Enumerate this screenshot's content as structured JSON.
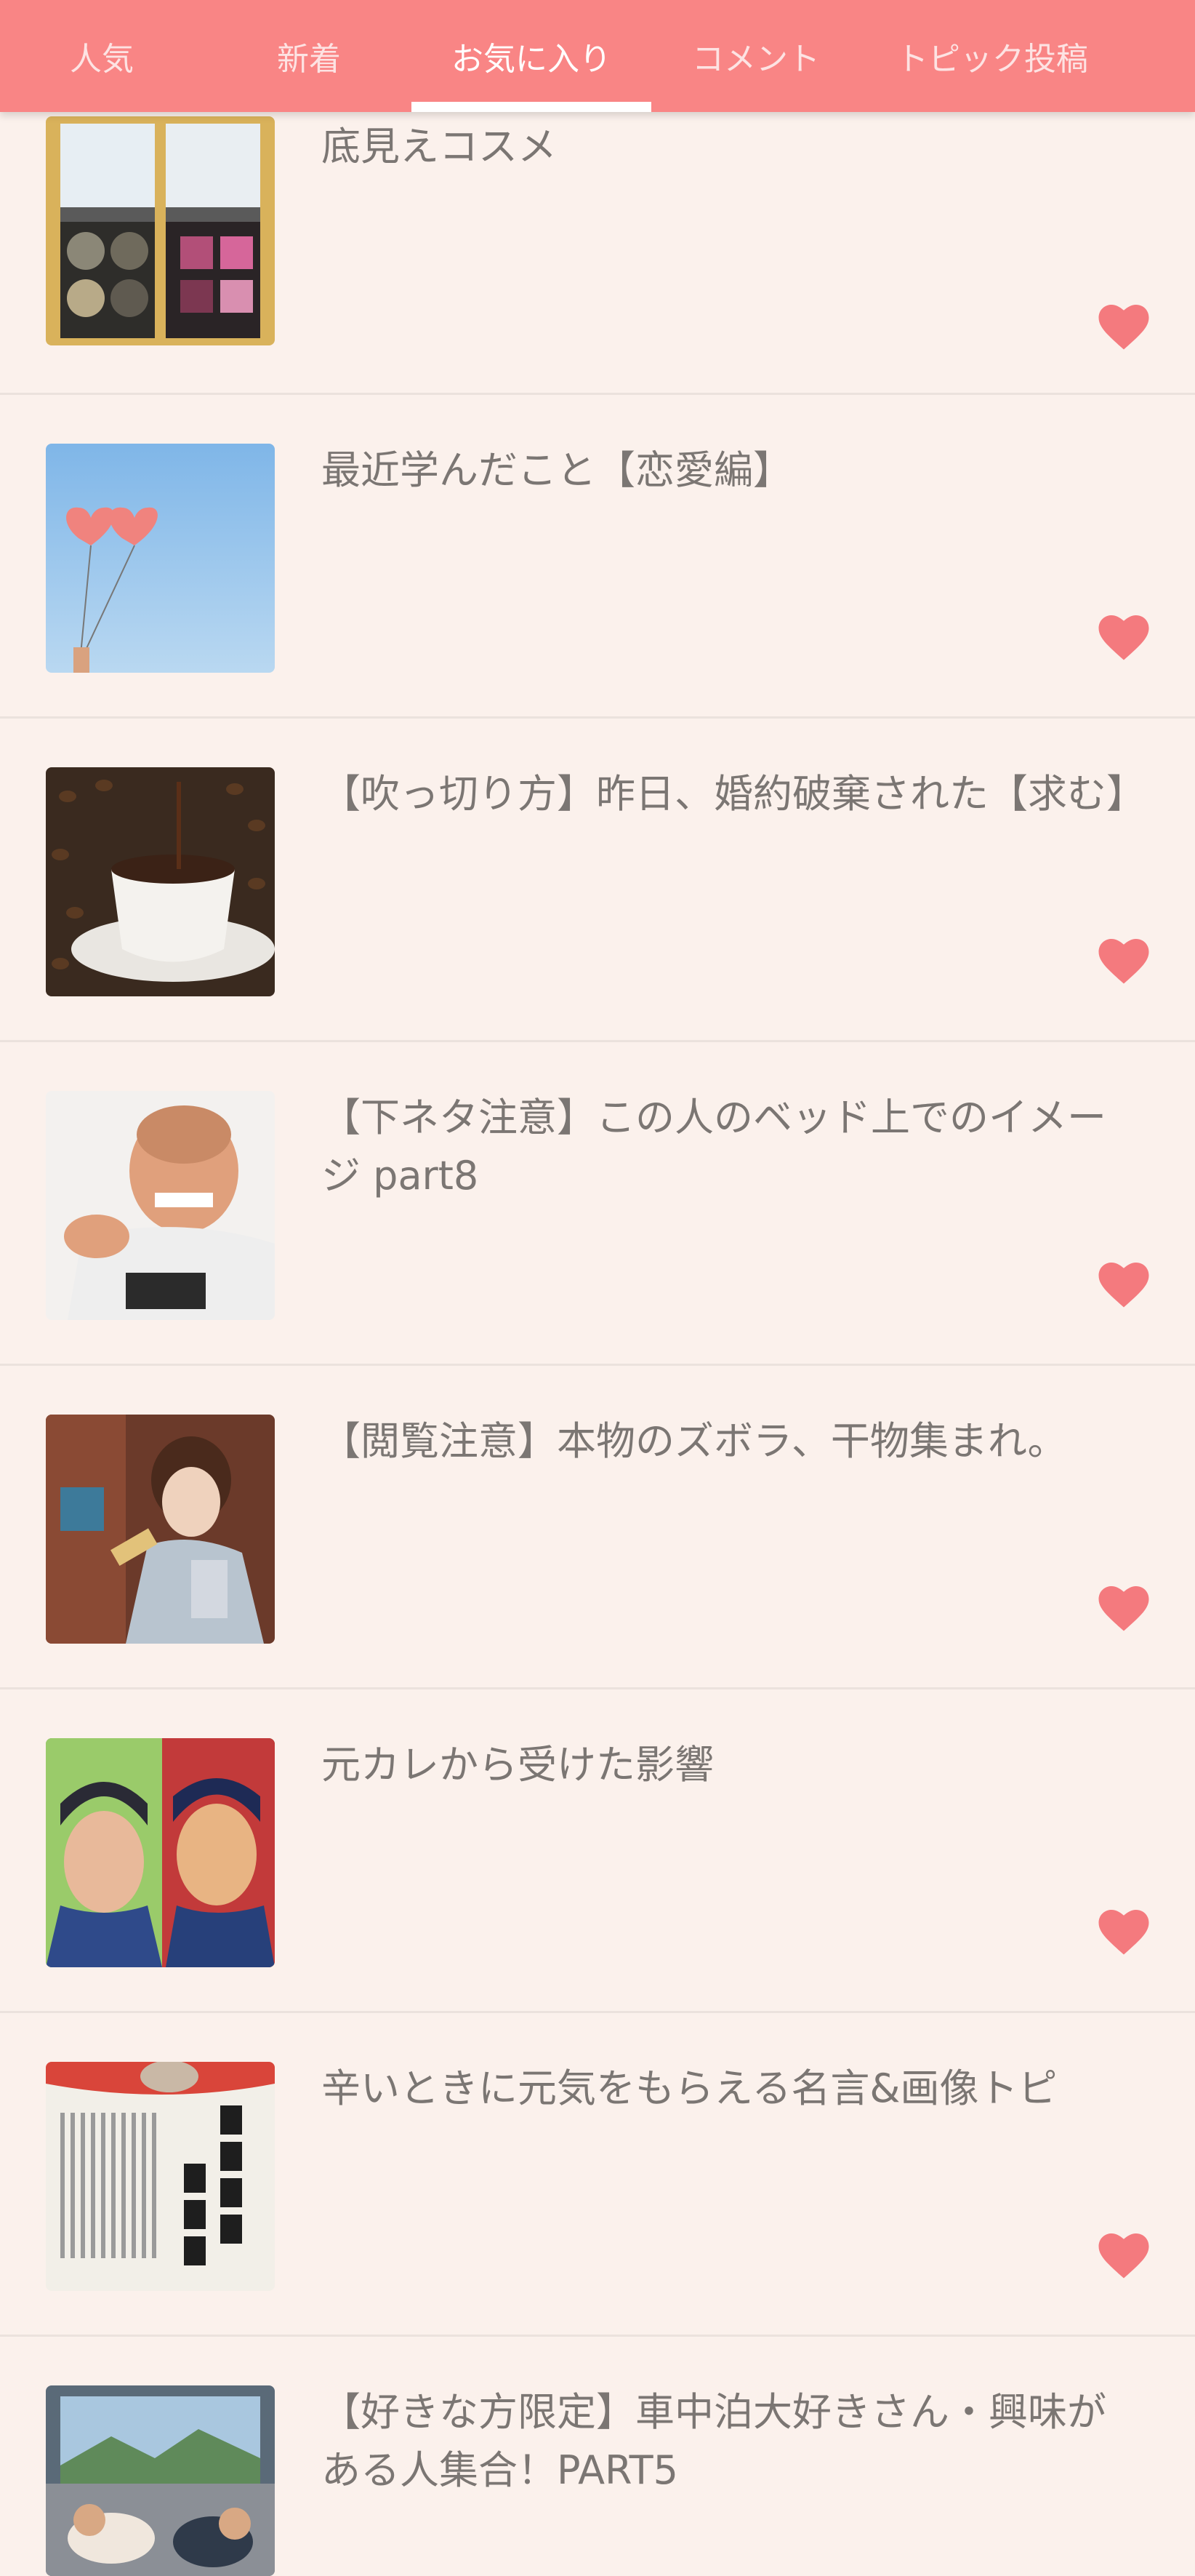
{
  "tabs": [
    {
      "label": "人気",
      "active": false
    },
    {
      "label": "新着",
      "active": false
    },
    {
      "label": "お気に入り",
      "active": true
    },
    {
      "label": "コメント",
      "active": false
    },
    {
      "label": "トピック投稿",
      "active": false
    }
  ],
  "colors": {
    "accent": "#f98585",
    "background": "#fbf1ec",
    "heart": "#f47a7e",
    "title_text": "#7b7673"
  },
  "items": [
    {
      "title": "底見えコスメ",
      "thumbnail_icon": "eyeshadow-palette-photo",
      "favorite_icon": "heart-icon"
    },
    {
      "title": "最近学んだこと【恋愛編】",
      "thumbnail_icon": "heart-balloons-photo",
      "favorite_icon": "heart-icon"
    },
    {
      "title": "【吹っ切り方】昨日、婚約破棄された【求む】",
      "thumbnail_icon": "coffee-cup-photo",
      "favorite_icon": "heart-icon"
    },
    {
      "title": "【下ネタ注意】この人のベッド上でのイメージ part8",
      "thumbnail_icon": "man-portrait-photo",
      "favorite_icon": "heart-icon"
    },
    {
      "title": "【閲覧注意】本物のズボラ、干物集まれ。",
      "thumbnail_icon": "woman-eating-photo",
      "favorite_icon": "heart-icon"
    },
    {
      "title": "元カレから受けた影響",
      "thumbnail_icon": "manga-characters-photo",
      "favorite_icon": "heart-icon"
    },
    {
      "title": "辛いときに元気をもらえる名言&画像トピ",
      "thumbnail_icon": "quote-poster-photo",
      "favorite_icon": "heart-icon"
    },
    {
      "title": "【好きな方限定】車中泊大好きさん・興味がある人集合！PART5",
      "thumbnail_icon": "car-camping-photo",
      "favorite_icon": "heart-icon"
    }
  ]
}
